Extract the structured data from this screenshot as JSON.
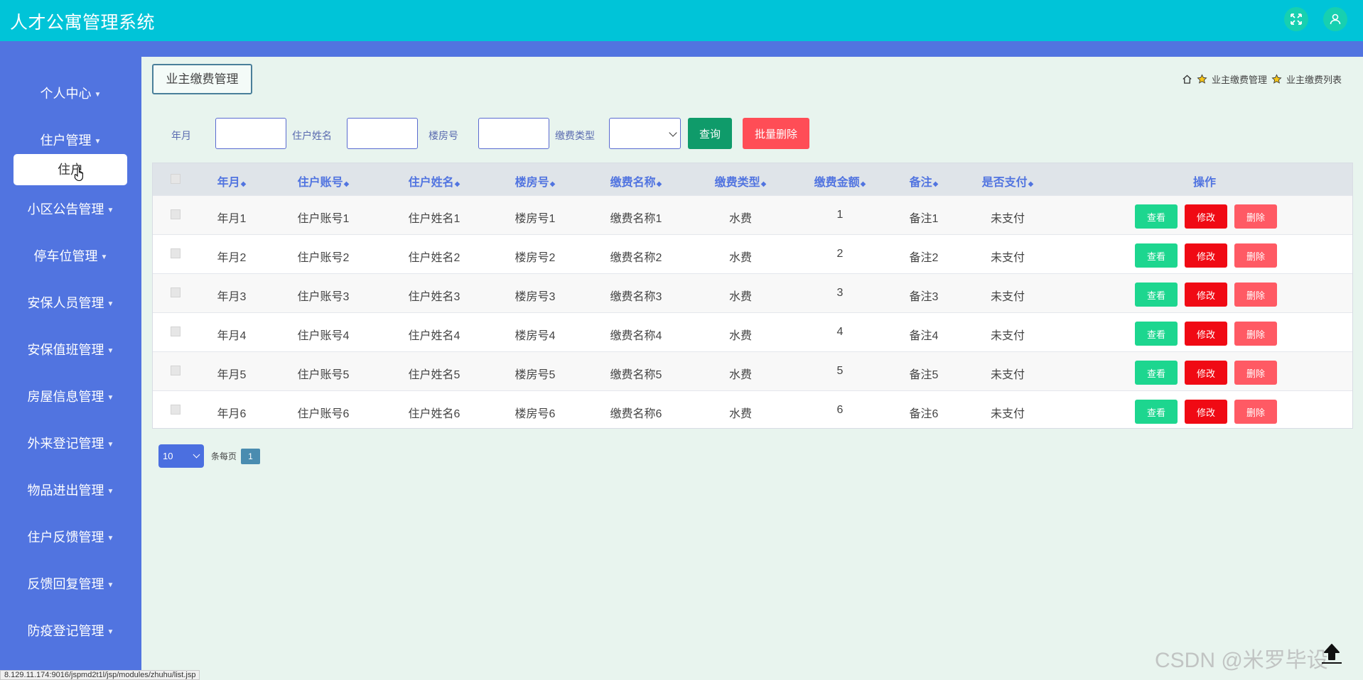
{
  "app": {
    "title": "人才公寓管理系统"
  },
  "topbar": {
    "icons": [
      "fullscreen-icon",
      "user-icon"
    ],
    "color": "#00c4d8"
  },
  "sidebar": {
    "color": "#5174e0",
    "items": [
      {
        "label": "个人中心"
      },
      {
        "label": "住户管理",
        "children": [
          "住户"
        ]
      },
      {
        "label": "小区公告管理"
      },
      {
        "label": "停车位管理"
      },
      {
        "label": "安保人员管理"
      },
      {
        "label": "安保值班管理"
      },
      {
        "label": "房屋信息管理"
      },
      {
        "label": "外来登记管理"
      },
      {
        "label": "物品进出管理"
      },
      {
        "label": "住户反馈管理"
      },
      {
        "label": "反馈回复管理"
      },
      {
        "label": "防疫登记管理"
      }
    ]
  },
  "page": {
    "tag": "业主缴费管理",
    "breadcrumb": [
      "业主缴费管理",
      "业主缴费列表"
    ]
  },
  "filter": {
    "labels": {
      "month": "年月",
      "resident_name": "住户姓名",
      "room": "楼房号",
      "fee_type": "缴费类型"
    },
    "values": {
      "month": "",
      "resident_name": "",
      "room": "",
      "fee_type": ""
    },
    "query_button": "查询",
    "batch_delete_button": "批量删除"
  },
  "table": {
    "headers": [
      "年月",
      "住户账号",
      "住户姓名",
      "楼房号",
      "缴费名称",
      "缴费类型",
      "缴费金额",
      "备注",
      "是否支付",
      "操作"
    ],
    "rows": [
      [
        "年月1",
        "住户账号1",
        "住户姓名1",
        "楼房号1",
        "缴费名称1",
        "水费",
        "1",
        "备注1",
        "未支付"
      ],
      [
        "年月2",
        "住户账号2",
        "住户姓名2",
        "楼房号2",
        "缴费名称2",
        "水费",
        "2",
        "备注2",
        "未支付"
      ],
      [
        "年月3",
        "住户账号3",
        "住户姓名3",
        "楼房号3",
        "缴费名称3",
        "水费",
        "3",
        "备注3",
        "未支付"
      ],
      [
        "年月4",
        "住户账号4",
        "住户姓名4",
        "楼房号4",
        "缴费名称4",
        "水费",
        "4",
        "备注4",
        "未支付"
      ],
      [
        "年月5",
        "住户账号5",
        "住户姓名5",
        "楼房号5",
        "缴费名称5",
        "水费",
        "5",
        "备注5",
        "未支付"
      ],
      [
        "年月6",
        "住户账号6",
        "住户姓名6",
        "楼房号6",
        "缴费名称6",
        "水费",
        "6",
        "备注6",
        "未支付"
      ]
    ],
    "actions": {
      "view": "查看",
      "edit": "修改",
      "delete": "删除"
    }
  },
  "pagination": {
    "page_size": "10",
    "per_page_text": "条每页",
    "current_page": "1"
  },
  "status_url": "8.129.11.174:9016/jspmd2t1l/jsp/modules/zhuhu/list.jsp",
  "watermark": "CSDN @米罗毕设"
}
